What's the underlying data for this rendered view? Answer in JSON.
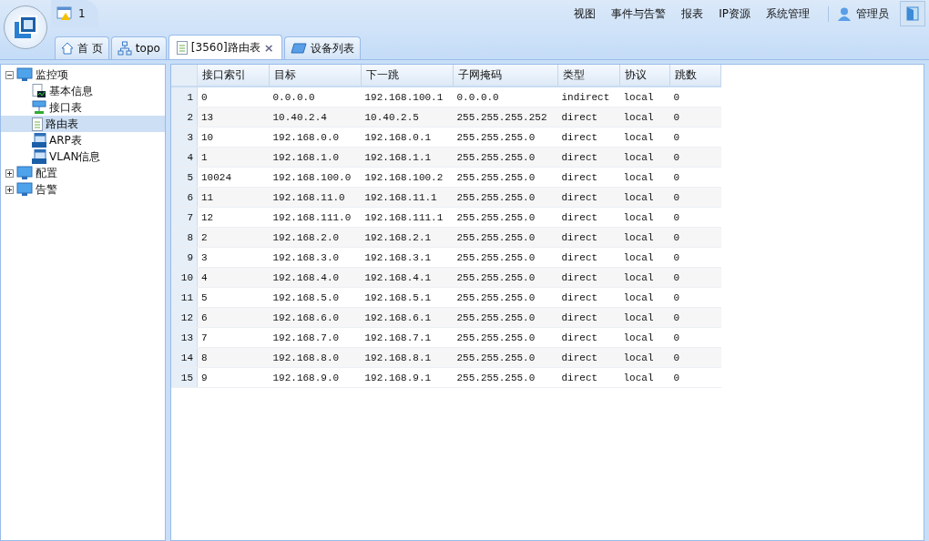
{
  "header": {
    "alert_count": "1",
    "menu": [
      {
        "label": "视图"
      },
      {
        "label": "事件与告警"
      },
      {
        "label": "报表"
      },
      {
        "label": "IP资源"
      },
      {
        "label": "系统管理"
      }
    ],
    "user": "管理员"
  },
  "tabs": [
    {
      "label": "首 页",
      "kind": "home",
      "selected": false
    },
    {
      "label": "topo",
      "kind": "topo",
      "selected": false
    },
    {
      "label": "[3560]路由表",
      "kind": "doc",
      "selected": true,
      "close": "×"
    },
    {
      "label": "设备列表",
      "kind": "device",
      "selected": false
    }
  ],
  "tree": [
    {
      "label": "监控项",
      "kind": "monitor",
      "expanded": true,
      "selected": false,
      "children": [
        {
          "label": "基本信息",
          "kind": "info",
          "selected": false
        },
        {
          "label": "接口表",
          "kind": "iface",
          "selected": false
        },
        {
          "label": "路由表",
          "kind": "doc",
          "selected": true
        },
        {
          "label": "ARP表",
          "kind": "window",
          "selected": false
        },
        {
          "label": "VLAN信息",
          "kind": "window",
          "selected": false
        }
      ]
    },
    {
      "label": "配置",
      "kind": "monitor",
      "expanded": false,
      "selected": false
    },
    {
      "label": "告警",
      "kind": "monitor",
      "expanded": false,
      "selected": false
    }
  ],
  "table": {
    "columns": [
      "接口索引",
      "目标",
      "下一跳",
      "子网掩码",
      "类型",
      "协议",
      "跳数"
    ],
    "rows": [
      {
        "n": "1",
        "cells": [
          "0",
          "0.0.0.0",
          "192.168.100.1",
          "0.0.0.0",
          "indirect",
          "local",
          "0"
        ]
      },
      {
        "n": "2",
        "cells": [
          "13",
          "10.40.2.4",
          "10.40.2.5",
          "255.255.255.252",
          "direct",
          "local",
          "0"
        ]
      },
      {
        "n": "3",
        "cells": [
          "10",
          "192.168.0.0",
          "192.168.0.1",
          "255.255.255.0",
          "direct",
          "local",
          "0"
        ]
      },
      {
        "n": "4",
        "cells": [
          "1",
          "192.168.1.0",
          "192.168.1.1",
          "255.255.255.0",
          "direct",
          "local",
          "0"
        ]
      },
      {
        "n": "5",
        "cells": [
          "10024",
          "192.168.100.0",
          "192.168.100.2",
          "255.255.255.0",
          "direct",
          "local",
          "0"
        ]
      },
      {
        "n": "6",
        "cells": [
          "11",
          "192.168.11.0",
          "192.168.11.1",
          "255.255.255.0",
          "direct",
          "local",
          "0"
        ]
      },
      {
        "n": "7",
        "cells": [
          "12",
          "192.168.111.0",
          "192.168.111.1",
          "255.255.255.0",
          "direct",
          "local",
          "0"
        ]
      },
      {
        "n": "8",
        "cells": [
          "2",
          "192.168.2.0",
          "192.168.2.1",
          "255.255.255.0",
          "direct",
          "local",
          "0"
        ]
      },
      {
        "n": "9",
        "cells": [
          "3",
          "192.168.3.0",
          "192.168.3.1",
          "255.255.255.0",
          "direct",
          "local",
          "0"
        ]
      },
      {
        "n": "10",
        "cells": [
          "4",
          "192.168.4.0",
          "192.168.4.1",
          "255.255.255.0",
          "direct",
          "local",
          "0"
        ]
      },
      {
        "n": "11",
        "cells": [
          "5",
          "192.168.5.0",
          "192.168.5.1",
          "255.255.255.0",
          "direct",
          "local",
          "0"
        ]
      },
      {
        "n": "12",
        "cells": [
          "6",
          "192.168.6.0",
          "192.168.6.1",
          "255.255.255.0",
          "direct",
          "local",
          "0"
        ]
      },
      {
        "n": "13",
        "cells": [
          "7",
          "192.168.7.0",
          "192.168.7.1",
          "255.255.255.0",
          "direct",
          "local",
          "0"
        ]
      },
      {
        "n": "14",
        "cells": [
          "8",
          "192.168.8.0",
          "192.168.8.1",
          "255.255.255.0",
          "direct",
          "local",
          "0"
        ]
      },
      {
        "n": "15",
        "cells": [
          "9",
          "192.168.9.0",
          "192.168.9.1",
          "255.255.255.0",
          "direct",
          "local",
          "0"
        ]
      }
    ]
  }
}
